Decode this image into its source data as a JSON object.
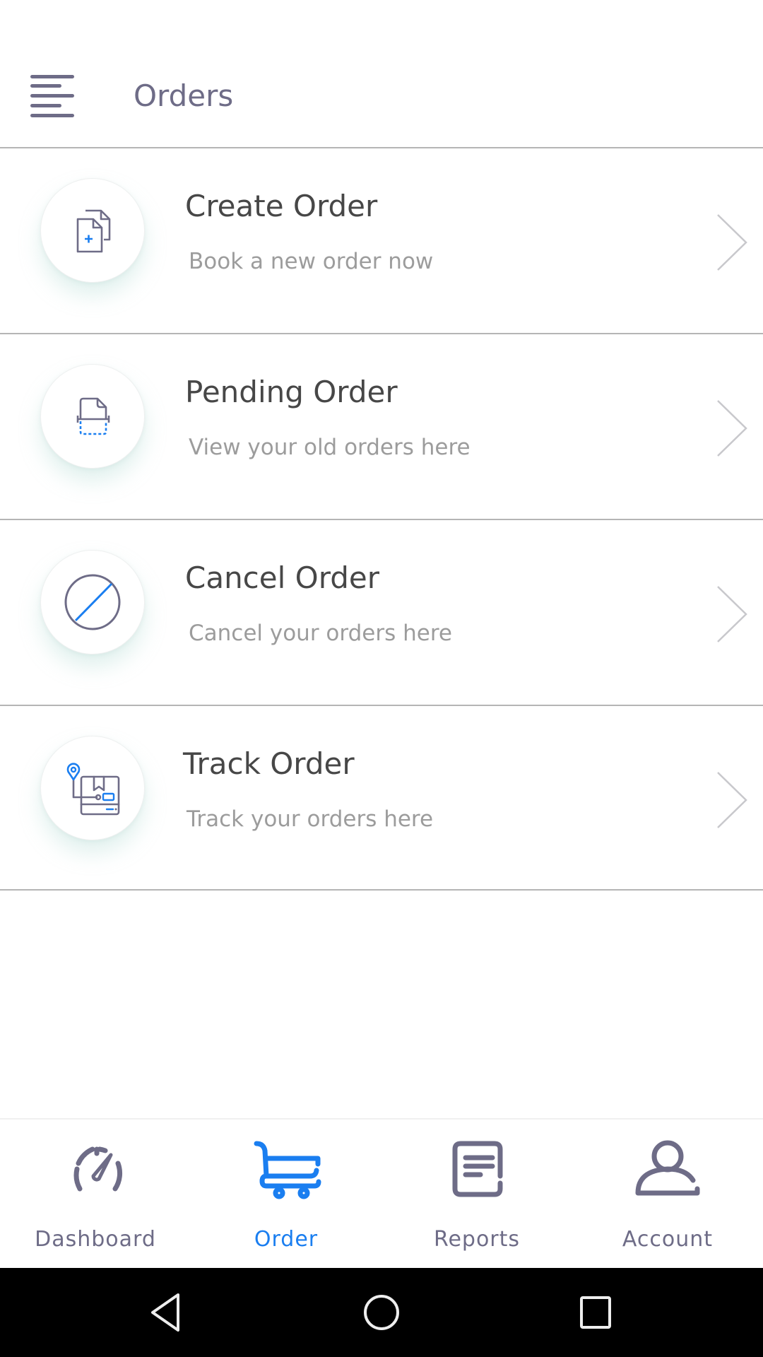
{
  "header": {
    "menu_icon": "hamburger-menu-icon",
    "title": "Orders"
  },
  "orders_menu": [
    {
      "title": "Create Order",
      "subtitle": "Book a new order now",
      "icon": "create-document-icon"
    },
    {
      "title": "Pending Order",
      "subtitle": "View your old orders here",
      "icon": "pending-document-icon"
    },
    {
      "title": "Cancel Order",
      "subtitle": "Cancel your orders here",
      "icon": "cancel-icon"
    },
    {
      "title": "Track Order",
      "subtitle": "Track your orders here",
      "icon": "track-package-icon"
    }
  ],
  "bottom_nav": {
    "active": "Order",
    "items": [
      {
        "label": "Dashboard",
        "icon": "speedometer-icon"
      },
      {
        "label": "Order",
        "icon": "cart-icon"
      },
      {
        "label": "Reports",
        "icon": "report-icon"
      },
      {
        "label": "Account",
        "icon": "user-icon"
      }
    ]
  },
  "colors": {
    "primary_text": "#6e6c87",
    "accent": "#1a7ef0",
    "title_text": "#474747",
    "subtitle_text": "#9c9c9c"
  },
  "system_nav": [
    "back",
    "home",
    "recents"
  ]
}
